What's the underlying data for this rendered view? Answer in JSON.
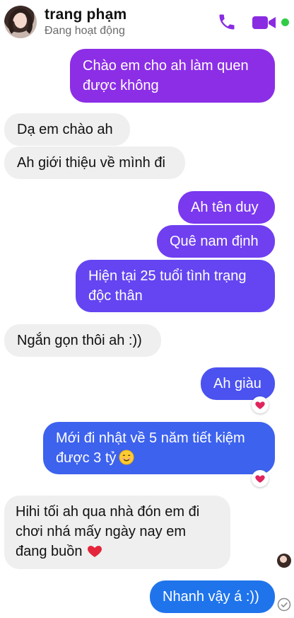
{
  "header": {
    "contact_name": "trang phạm",
    "status": "Đang hoạt động",
    "accent_color": "#8a2be2",
    "online_color": "#31cc46"
  },
  "icons": {
    "call": "phone-icon",
    "video": "video-camera-icon",
    "reaction": "heart-icon",
    "smile": "smiling-face-emoji",
    "heart": "red-heart-emoji",
    "sent": "check-circle-icon"
  },
  "messages": [
    {
      "side": "out",
      "lines": [
        "Chào em cho ah làm quen",
        "được không"
      ]
    },
    {
      "side": "in",
      "lines": [
        "Dạ em chào ah"
      ]
    },
    {
      "side": "in",
      "lines": [
        "Ah giới thiệu về mình đi"
      ]
    },
    {
      "side": "out",
      "lines": [
        "Ah tên duy"
      ]
    },
    {
      "side": "out",
      "lines": [
        "Quê nam định"
      ]
    },
    {
      "side": "out",
      "lines": [
        "Hiện tại 25 tuổi tình trạng",
        "độc thân"
      ]
    },
    {
      "side": "in",
      "lines": [
        "Ngắn gọn thôi ah :))"
      ]
    },
    {
      "side": "out",
      "lines": [
        "Ah giàu"
      ],
      "reaction": "heart"
    },
    {
      "side": "out",
      "lines": [
        "Mới đi nhật về 5 năm tiết kiệm",
        "được 3 tỷ"
      ],
      "emoji": "smile",
      "reaction": "heart"
    },
    {
      "side": "in",
      "lines": [
        "Hihi tối ah qua nhà đón em đi",
        "chơi nhá mấy ngày nay em",
        "đang buồn"
      ],
      "emoji": "heart"
    },
    {
      "side": "out",
      "lines": [
        "Nhanh vậy á :))"
      ]
    }
  ]
}
